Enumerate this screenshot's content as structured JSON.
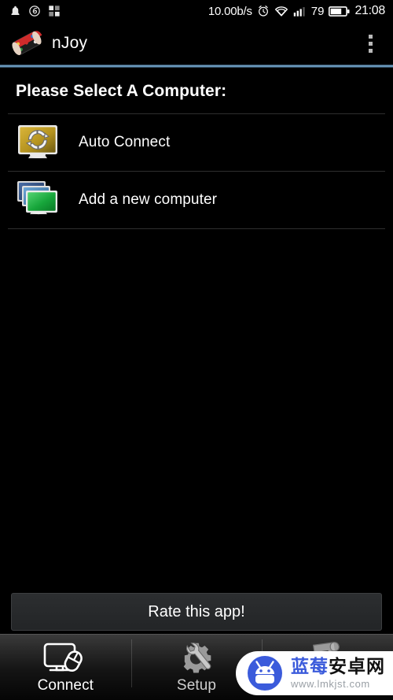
{
  "status_bar": {
    "icons_left": [
      "notification-bell-icon",
      "music-app-icon",
      "squares-app-icon"
    ],
    "network_speed": "10.00b/s",
    "alarm_icon": "alarm-clock-icon",
    "wifi_icon": "wifi-icon",
    "signal_icon": "cell-signal-icon",
    "battery_percent": "79",
    "battery_icon": "battery-icon",
    "clock": "21:08"
  },
  "action_bar": {
    "app_icon": "gamepad-logo-icon",
    "title": "nJoy",
    "overflow_menu": "overflow-menu-icon",
    "accent_color": "#7ba9cc"
  },
  "main": {
    "page_title": "Please Select A Computer:",
    "items": [
      {
        "icon": "auto-connect-monitor-icon",
        "label": "Auto Connect"
      },
      {
        "icon": "add-computer-monitors-icon",
        "label": "Add a new computer"
      }
    ]
  },
  "rate_button": {
    "label": "Rate this app!"
  },
  "tab_bar": {
    "tabs": [
      {
        "label": "Connect",
        "icon": "monitor-mouse-icon",
        "active": true
      },
      {
        "label": "Setup",
        "icon": "wrench-gear-icon",
        "active": false
      },
      {
        "label": "",
        "icon": "log-scroll-icon",
        "active": false
      }
    ]
  },
  "watermark": {
    "logo": "android-robot-icon",
    "site_name_1": "蓝莓",
    "site_name_2": "安卓网",
    "url": "www.lmkjst.com"
  },
  "colors": {
    "accent_blue": "#7ba9cc",
    "auto_connect_gold": "#c9a227",
    "add_computer_green": "#2fb24a",
    "watermark_blue": "#3b5bdb"
  }
}
